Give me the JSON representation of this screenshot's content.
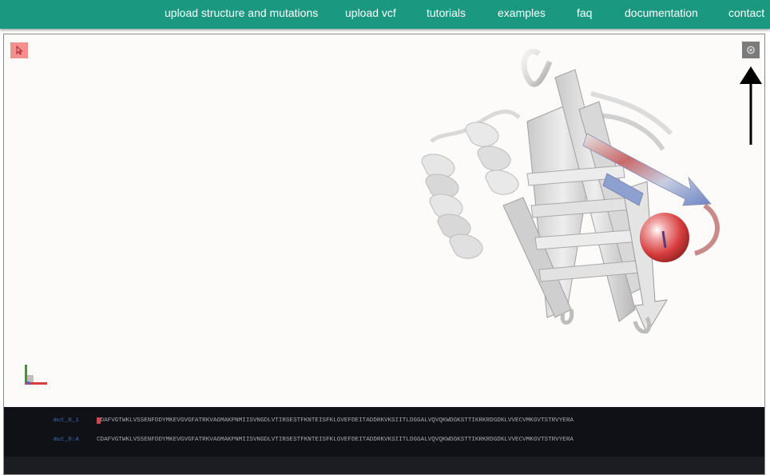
{
  "nav": {
    "items": [
      "upload structure and mutations",
      "upload vcf",
      "tutorials",
      "examples",
      "faq",
      "documentation",
      "contact"
    ]
  },
  "viewer": {
    "select_icon": "cursor-icon",
    "expand_icon": "expand-icon",
    "annotation_icon": "arrow-up-icon"
  },
  "sequences": [
    {
      "label": "mut_0_1",
      "first": "C",
      "rest": "DAFVGTWKLVSSENFDDYMKEVGVGFATRKVAGMAKPNMIISVNGDLVTIRSESTFKNTEISFKLGVEFDEITADDRKVKSIITLDGGALVQVQKWDGKSTTIKRKRDGDKLVVECVMKGVTSTRVYERA"
    },
    {
      "label": "mut_0:A",
      "first": "",
      "rest": "CDAFVGTWKLVSSENFDDYMKEVGVGFATRKVAGMAKPNMIISVNGDLVTIRSESTFKNTEISFKLGVEFDEITADDRKVKSIITLDGGALVQVQKWDGKSTTIKRKRDGDKLVVECVMKGVTSTRVYERA"
    }
  ],
  "colors": {
    "nav_bg": "#1a9980",
    "highlight": "#e83a4a",
    "mutation_sphere": "#d42c2c"
  }
}
